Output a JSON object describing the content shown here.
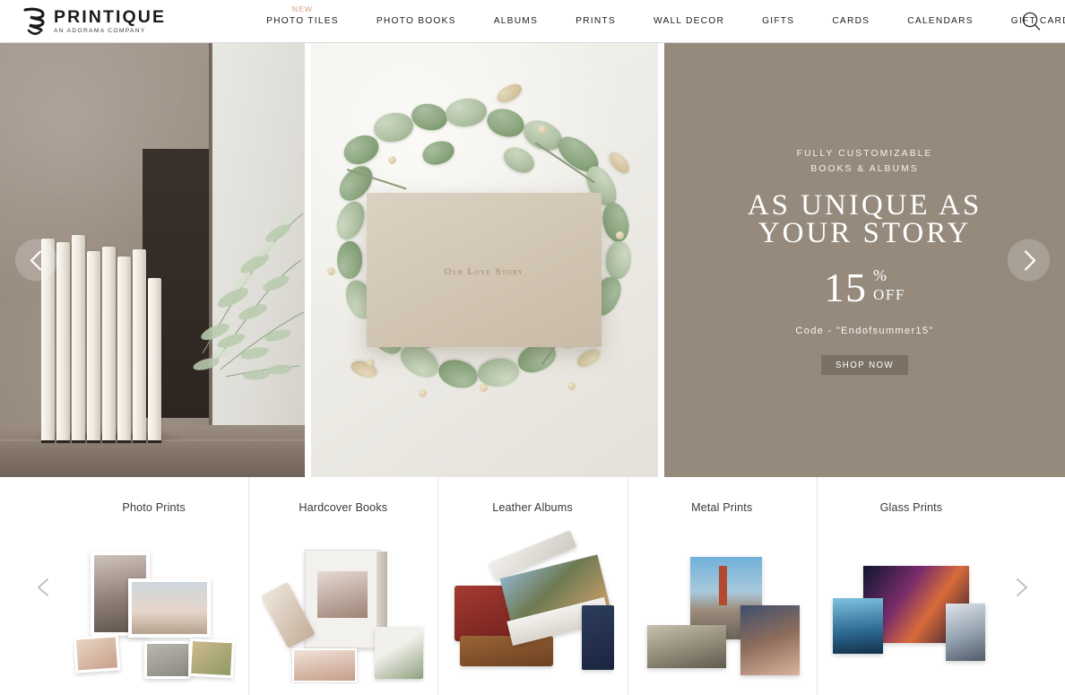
{
  "header": {
    "logo": {
      "name": "PRINTIQUE",
      "tagline": "AN ADORAMA COMPANY",
      "mark_icon": "printique-swirl-logo-icon"
    },
    "nav_items": [
      {
        "label": "PHOTO TILES",
        "badge": "NEW"
      },
      {
        "label": "PHOTO BOOKS",
        "badge": ""
      },
      {
        "label": "ALBUMS",
        "badge": ""
      },
      {
        "label": "PRINTS",
        "badge": ""
      },
      {
        "label": "WALL DECOR",
        "badge": ""
      },
      {
        "label": "GIFTS",
        "badge": ""
      },
      {
        "label": "CARDS",
        "badge": ""
      },
      {
        "label": "CALENDARS",
        "badge": ""
      },
      {
        "label": "GIFT CARDS",
        "badge": ""
      }
    ],
    "search_icon": "search-icon"
  },
  "hero": {
    "prev_icon": "chevron-left-icon",
    "next_icon": "chevron-right-icon",
    "panel_album_text": "Our Love Story",
    "promo": {
      "eyebrow_line1": "FULLY CUSTOMIZABLE",
      "eyebrow_line2": "BOOKS & ALBUMS",
      "headline_line1": "AS UNIQUE AS",
      "headline_line2": "YOUR STORY",
      "discount_number": "15",
      "discount_percent": "%",
      "discount_off": "OFF",
      "code_text": "Code - \"Endofsummer15\"",
      "cta_label": "SHOP NOW",
      "background_color": "#958a7c",
      "cta_color": "#7b7164"
    }
  },
  "categories": {
    "prev_icon": "chevron-left-icon",
    "next_icon": "chevron-right-icon",
    "items": [
      {
        "label": "Photo Prints"
      },
      {
        "label": "Hardcover Books"
      },
      {
        "label": "Leather Albums"
      },
      {
        "label": "Metal Prints"
      },
      {
        "label": "Glass Prints"
      }
    ]
  }
}
